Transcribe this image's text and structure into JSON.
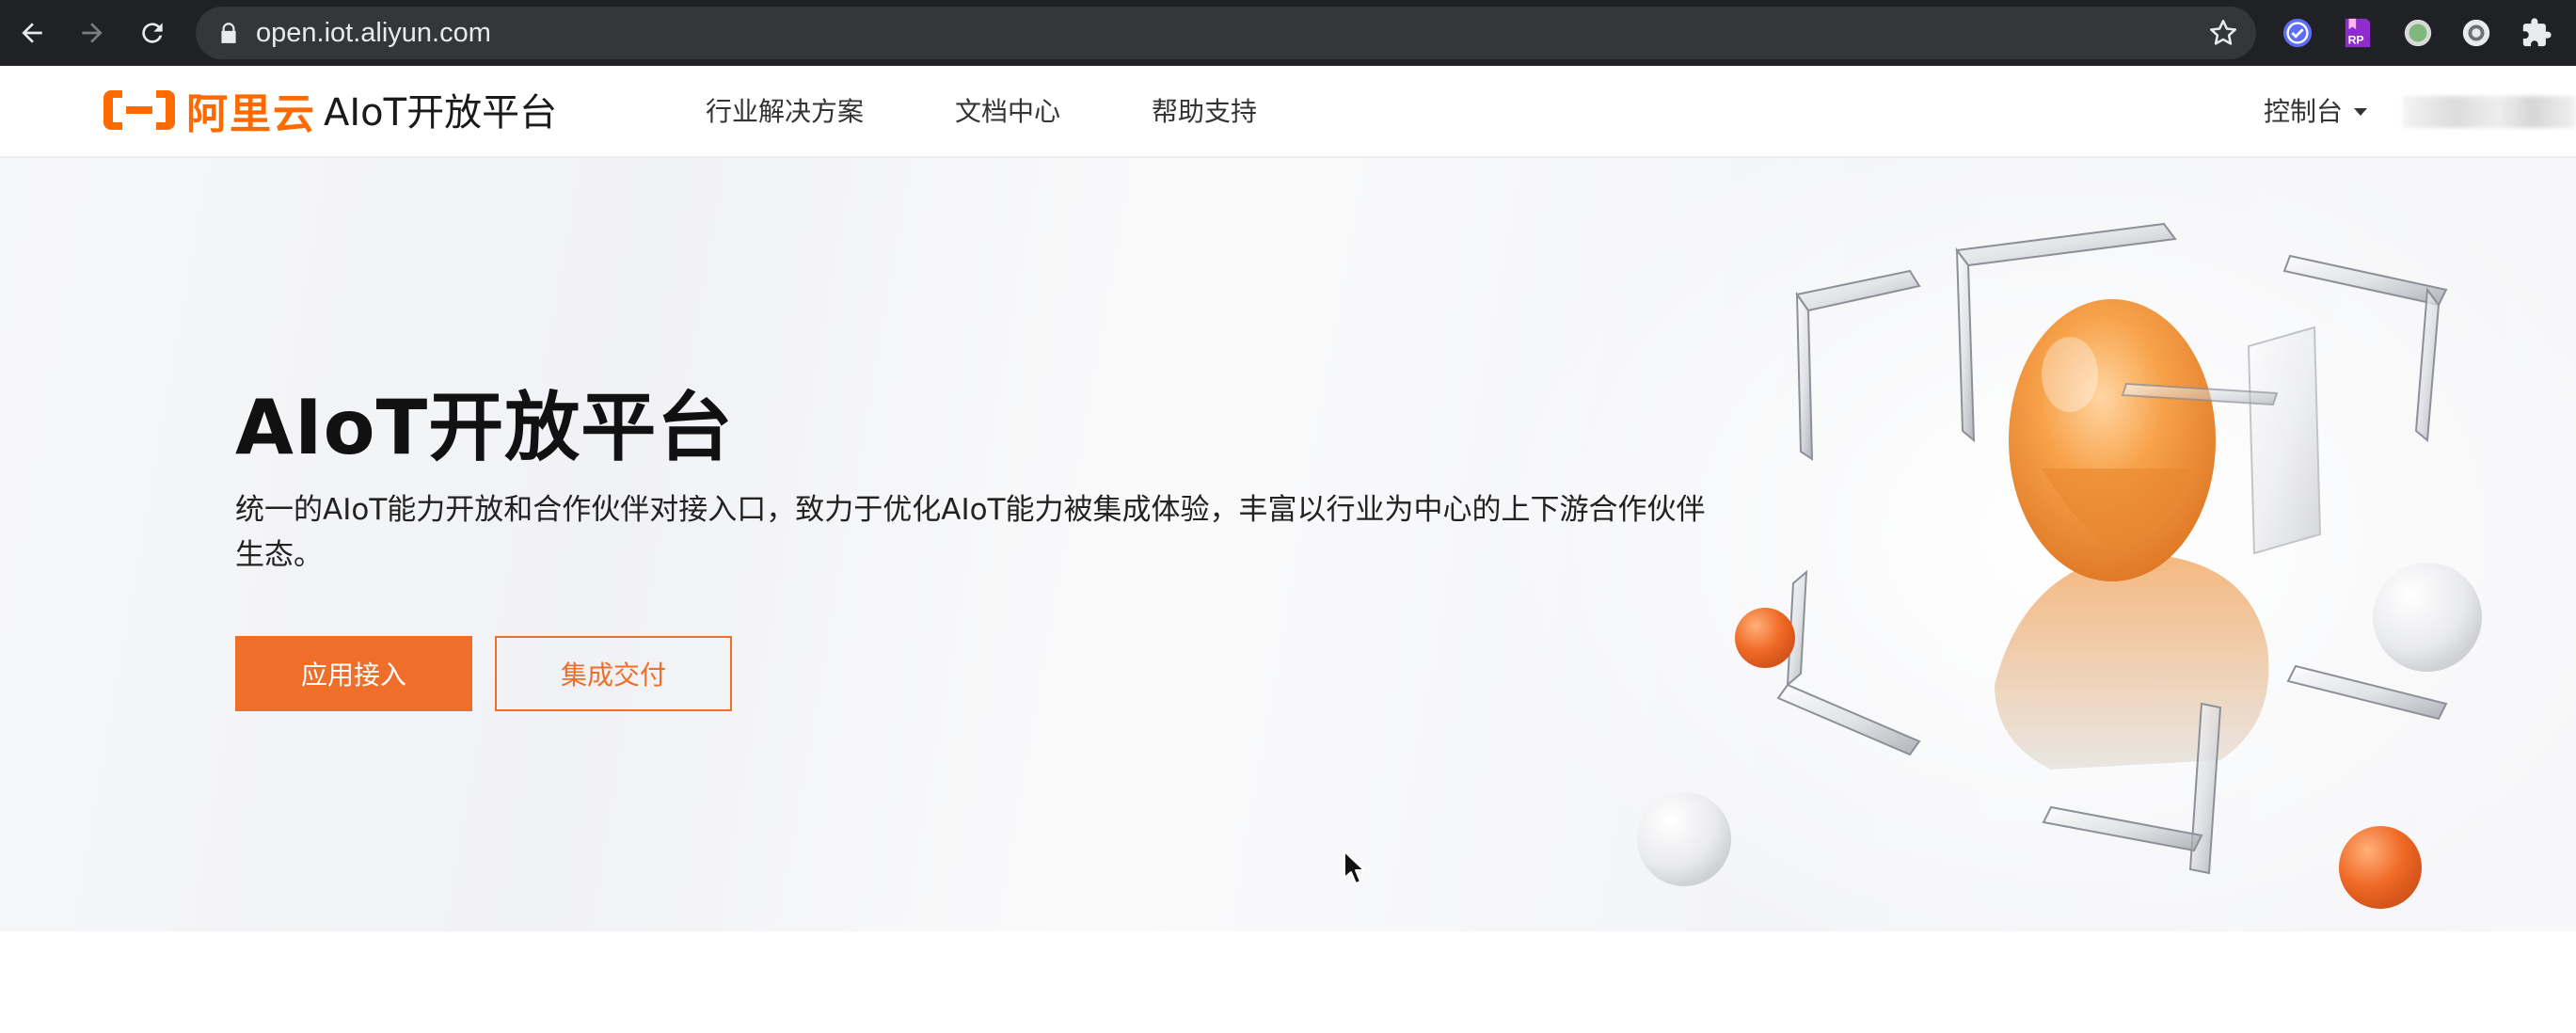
{
  "browser": {
    "url": "open.iot.aliyun.com",
    "extensions": [
      {
        "name": "checkmark-shield-extension-icon",
        "color": "#5b6ef5"
      },
      {
        "name": "rp-extension-icon",
        "color": "#8e2dc9",
        "label": "RP"
      },
      {
        "name": "green-circle-extension-icon",
        "color": "#7fb77e"
      },
      {
        "name": "circle-extension-icon",
        "color": "#cfcfcf"
      },
      {
        "name": "puzzle-extension-icon",
        "color": "#e8eaed"
      }
    ]
  },
  "header": {
    "logo_text": "阿里云",
    "platform_name": "AIoT开放平台",
    "nav": [
      {
        "label": "行业解决方案"
      },
      {
        "label": "文档中心"
      },
      {
        "label": "帮助支持"
      }
    ],
    "console_label": "控制台"
  },
  "hero": {
    "title": "AIoT开放平台",
    "description": "统一的AIoT能力开放和合作伙伴对接入口，致力于优化AIoT能力被集成体验，丰富以行业为中心的上下游合作伙伴生态。",
    "primary_button": "应用接入",
    "secondary_button": "集成交付"
  },
  "colors": {
    "brand": "#ff6a00",
    "accent": "#ef6e2a",
    "chrome_bg": "#202124",
    "omnibox_bg": "#35363a"
  }
}
